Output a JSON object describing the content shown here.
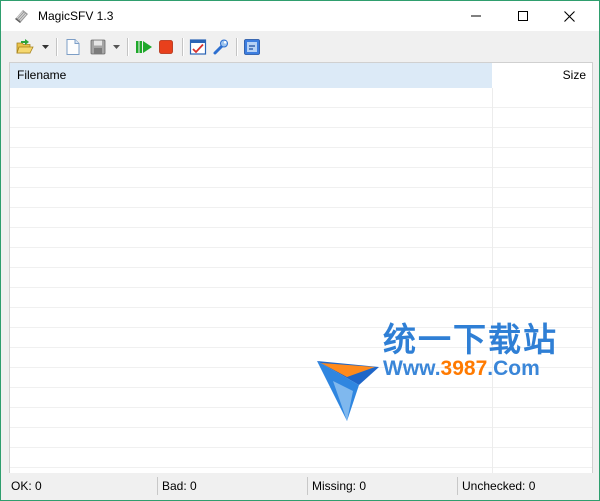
{
  "window": {
    "title": "MagicSFV 1.3",
    "icon": "magicsfv-app-icon",
    "controls": [
      "minimize-icon",
      "maximize-icon",
      "close-icon"
    ]
  },
  "toolbar": {
    "buttons": [
      {
        "icon": "open-folder-icon"
      },
      {
        "icon": "chevron-down-icon"
      },
      {
        "icon": "new-file-icon"
      },
      {
        "icon": "save-icon"
      },
      {
        "icon": "chevron-down-icon"
      },
      {
        "icon": "start-check-icon"
      },
      {
        "icon": "stop-icon"
      },
      {
        "icon": "report-icon"
      },
      {
        "icon": "settings-tools-icon"
      },
      {
        "icon": "about-icon"
      }
    ]
  },
  "list": {
    "columns": [
      "Filename",
      "Size"
    ],
    "rows": []
  },
  "statusbar": {
    "ok": "OK: 0",
    "bad": "Bad: 0",
    "missing": "Missing: 0",
    "unchecked": "Unchecked: 0"
  },
  "watermark": {
    "site_name": "统一下载站",
    "url_prefix": "Www.",
    "url_number": "3987",
    "url_suffix": ".Com"
  },
  "colors": {
    "window_border": "#2f9e6e",
    "header_highlight": "#dceaf7",
    "watermark_blue": "#2f7fd5",
    "watermark_orange": "#ff7a00",
    "stop_red": "#e8401c",
    "start_green": "#1ea82a"
  }
}
